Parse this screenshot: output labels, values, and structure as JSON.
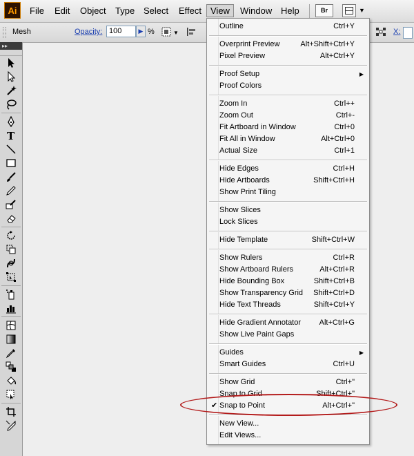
{
  "app": {
    "logo_text": "Ai",
    "brand_color": "#ff9a00"
  },
  "menubar": {
    "items": [
      {
        "label": "File"
      },
      {
        "label": "Edit"
      },
      {
        "label": "Object"
      },
      {
        "label": "Type"
      },
      {
        "label": "Select"
      },
      {
        "label": "Effect"
      },
      {
        "label": "View",
        "active": true
      },
      {
        "label": "Window"
      },
      {
        "label": "Help"
      }
    ],
    "bridge_button": "Br",
    "workspace_icon": "workspace-switcher-icon"
  },
  "controlbar": {
    "selection_label": "Mesh",
    "opacity_label": "Opacity:",
    "opacity_value": "100",
    "percent": "%",
    "x_label": "X:"
  },
  "view_menu": {
    "items": [
      {
        "label": "Outline",
        "shortcut": "Ctrl+Y"
      },
      {
        "label": "Overprint Preview",
        "shortcut": "Alt+Shift+Ctrl+Y"
      },
      {
        "label": "Pixel Preview",
        "shortcut": "Alt+Ctrl+Y"
      },
      {
        "label": "Proof Setup",
        "shortcut": "",
        "submenu": true
      },
      {
        "label": "Proof Colors",
        "shortcut": ""
      },
      {
        "label": "Zoom In",
        "shortcut": "Ctrl++"
      },
      {
        "label": "Zoom Out",
        "shortcut": "Ctrl+-"
      },
      {
        "label": "Fit Artboard in Window",
        "shortcut": "Ctrl+0"
      },
      {
        "label": "Fit All in Window",
        "shortcut": "Alt+Ctrl+0"
      },
      {
        "label": "Actual Size",
        "shortcut": "Ctrl+1"
      },
      {
        "label": "Hide Edges",
        "shortcut": "Ctrl+H"
      },
      {
        "label": "Hide Artboards",
        "shortcut": "Shift+Ctrl+H"
      },
      {
        "label": "Show Print Tiling",
        "shortcut": ""
      },
      {
        "label": "Show Slices",
        "shortcut": ""
      },
      {
        "label": "Lock Slices",
        "shortcut": ""
      },
      {
        "label": "Hide Template",
        "shortcut": "Shift+Ctrl+W"
      },
      {
        "label": "Show Rulers",
        "shortcut": "Ctrl+R"
      },
      {
        "label": "Show Artboard Rulers",
        "shortcut": "Alt+Ctrl+R"
      },
      {
        "label": "Hide Bounding Box",
        "shortcut": "Shift+Ctrl+B"
      },
      {
        "label": "Show Transparency Grid",
        "shortcut": "Shift+Ctrl+D"
      },
      {
        "label": "Hide Text Threads",
        "shortcut": "Shift+Ctrl+Y"
      },
      {
        "label": "Hide Gradient Annotator",
        "shortcut": "Alt+Ctrl+G"
      },
      {
        "label": "Show Live Paint Gaps",
        "shortcut": ""
      },
      {
        "label": "Guides",
        "shortcut": "",
        "submenu": true
      },
      {
        "label": "Smart Guides",
        "shortcut": "Ctrl+U"
      },
      {
        "label": "Show Grid",
        "shortcut": "Ctrl+\""
      },
      {
        "label": "Snap to Grid",
        "shortcut": "Shift+Ctrl+\""
      },
      {
        "label": "Snap to Point",
        "shortcut": "Alt+Ctrl+\"",
        "checked": true
      },
      {
        "label": "New View...",
        "shortcut": ""
      },
      {
        "label": "Edit Views...",
        "shortcut": ""
      }
    ],
    "highlight_color": "#b31b1b"
  }
}
